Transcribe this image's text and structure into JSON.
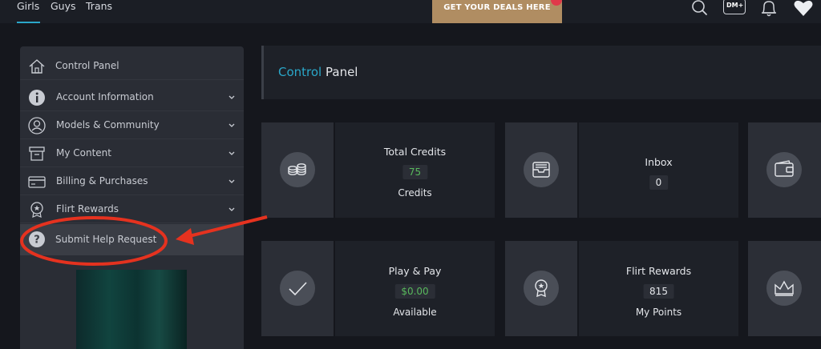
{
  "topnav": {
    "tabs": [
      {
        "label": "Girls",
        "active": true
      },
      {
        "label": "Guys",
        "active": false
      },
      {
        "label": "Trans",
        "active": false
      }
    ],
    "deal_banner": "GET YOUR DEALS HERE",
    "dm_badge": "DM+",
    "icons": [
      "search-icon",
      "dm-plus-icon",
      "bell-icon",
      "heart-icon"
    ]
  },
  "sidebar": {
    "items": [
      {
        "label": "Control Panel",
        "icon": "home-icon",
        "chevron": false
      },
      {
        "label": "Account Information",
        "icon": "info-icon",
        "chevron": true
      },
      {
        "label": "Models & Community",
        "icon": "user-icon",
        "chevron": true
      },
      {
        "label": "My Content",
        "icon": "archive-icon",
        "chevron": true
      },
      {
        "label": "Billing & Purchases",
        "icon": "credit-card-icon",
        "chevron": true
      },
      {
        "label": "Flirt Rewards",
        "icon": "badge-icon",
        "chevron": true
      },
      {
        "label": "Submit Help Request",
        "icon": "help-icon",
        "chevron": false
      }
    ]
  },
  "main": {
    "title_accent": "Control",
    "title_rest": " Panel",
    "tiles": [
      {
        "title": "Total Credits",
        "value": "75",
        "value_color": "green",
        "sub": "Credits",
        "icon": "coins-icon"
      },
      {
        "title": "Inbox",
        "value": "0",
        "value_color": "white",
        "sub": "",
        "icon": "inbox-icon"
      },
      {
        "title": "",
        "value": "",
        "sub": "",
        "icon": "wallet-icon"
      },
      {
        "title": "Play & Pay",
        "value": "$0.00",
        "value_color": "green",
        "sub": "Available",
        "icon": "check-icon"
      },
      {
        "title": "Flirt Rewards",
        "value": "815",
        "value_color": "white",
        "sub": "My Points",
        "icon": "medal-icon"
      },
      {
        "title": "",
        "value": "",
        "sub": "",
        "icon": "crown-icon"
      }
    ]
  },
  "colors": {
    "accent": "#2aa7c9",
    "green_value": "#58b85c",
    "annotation": "#e5321f",
    "deal_bg": "#b08d62"
  }
}
